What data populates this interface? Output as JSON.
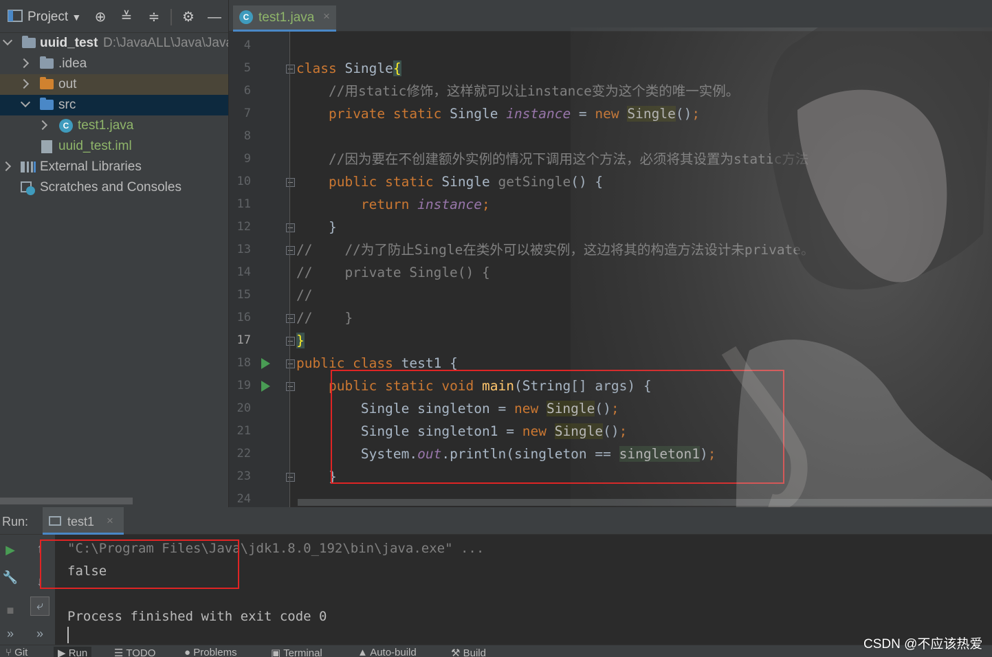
{
  "project_panel": {
    "title": "Project",
    "tree": [
      {
        "label": "uuid_test",
        "path": "D:\\JavaALL\\Java\\Java-",
        "expanded": true
      },
      {
        "label": ".idea"
      },
      {
        "label": "out"
      },
      {
        "label": "src",
        "expanded": true
      },
      {
        "label": "test1.java"
      },
      {
        "label": "uuid_test.iml"
      },
      {
        "label": "External Libraries"
      },
      {
        "label": "Scratches and Consoles"
      }
    ]
  },
  "editor": {
    "tab": {
      "label": "test1.java",
      "close": "×"
    },
    "line_numbers": [
      "4",
      "5",
      "6",
      "7",
      "8",
      "9",
      "10",
      "11",
      "12",
      "13",
      "14",
      "15",
      "16",
      "17",
      "18",
      "19",
      "20",
      "21",
      "22",
      "23",
      "24"
    ],
    "current_line": "17",
    "code_lines": [
      [],
      [
        [
          "kw",
          "class "
        ],
        [
          "pl",
          "Single"
        ],
        [
          "brace",
          "{"
        ]
      ],
      [
        [
          "pl",
          "    "
        ],
        [
          "cm",
          "//用static修饰，这样就可以让instance变为这个类的唯一实例。"
        ]
      ],
      [
        [
          "pl",
          "    "
        ],
        [
          "kw",
          "private static "
        ],
        [
          "pl",
          "Single "
        ],
        [
          "st",
          "instance"
        ],
        [
          "pl",
          " = "
        ],
        [
          "kw",
          "new "
        ],
        [
          "hl",
          "Single"
        ],
        [
          "pl",
          "()"
        ],
        [
          "kw",
          ";"
        ]
      ],
      [],
      [
        [
          "pl",
          "    "
        ],
        [
          "cm",
          "//因为要在不创建额外实例的情况下调用这个方法，必须将其设置为static方法"
        ]
      ],
      [
        [
          "pl",
          "    "
        ],
        [
          "kw",
          "public static "
        ],
        [
          "pl",
          "Single "
        ],
        [
          "mt",
          "getSingle"
        ],
        [
          "pl",
          "() {"
        ]
      ],
      [
        [
          "pl",
          "        "
        ],
        [
          "kw",
          "return "
        ],
        [
          "st",
          "instance"
        ],
        [
          "kw",
          ";"
        ]
      ],
      [
        [
          "pl",
          "    }"
        ]
      ],
      [
        [
          "cm",
          "//    //为了防止Single在类外可以被实例，这边将其的构造方法设计未private。"
        ]
      ],
      [
        [
          "cm",
          "//    private Single() {"
        ]
      ],
      [
        [
          "cm",
          "//"
        ]
      ],
      [
        [
          "cm",
          "//    }"
        ]
      ],
      [
        [
          "brace",
          "}"
        ]
      ],
      [
        [
          "kw",
          "public class "
        ],
        [
          "pl",
          "test1 {"
        ]
      ],
      [
        [
          "pl",
          "    "
        ],
        [
          "kw",
          "public static void "
        ],
        [
          "fn",
          "main"
        ],
        [
          "pl",
          "(String[] args) {"
        ]
      ],
      [
        [
          "pl",
          "        Single singleton = "
        ],
        [
          "kw",
          "new "
        ],
        [
          "hl",
          "Single"
        ],
        [
          "pl",
          "()"
        ],
        [
          "kw",
          ";"
        ]
      ],
      [
        [
          "pl",
          "        Single singleton1 = "
        ],
        [
          "kw",
          "new "
        ],
        [
          "hl",
          "Single"
        ],
        [
          "pl",
          "()"
        ],
        [
          "kw",
          ";"
        ]
      ],
      [
        [
          "pl",
          "        System."
        ],
        [
          "st",
          "out"
        ],
        [
          "pl",
          ".println(singleton == "
        ],
        [
          "hl2",
          "singleton1"
        ],
        [
          "pl",
          ")"
        ],
        [
          "kw",
          ";"
        ]
      ],
      [
        [
          "pl",
          "    }"
        ]
      ],
      []
    ]
  },
  "run_panel": {
    "label": "Run:",
    "tab": {
      "label": "test1",
      "close": "×"
    },
    "console": {
      "command": "\"C:\\Program Files\\Java\\jdk1.8.0_192\\bin\\java.exe\" ...",
      "output": "false",
      "exit": "Process finished with exit code 0"
    }
  },
  "bottom_bar": [
    "Git",
    "Run",
    "TODO",
    "Problems",
    "Terminal",
    "Auto-build",
    "Build"
  ],
  "watermark": "CSDN @不应该热爱",
  "colors": {
    "keyword": "#cc7832",
    "comment": "#808080",
    "plain": "#a9b7c6",
    "static_field": "#9876aa",
    "method": "#ffc66d",
    "highlight_box": "#e02424",
    "accent_tab": "#4a88c7"
  }
}
